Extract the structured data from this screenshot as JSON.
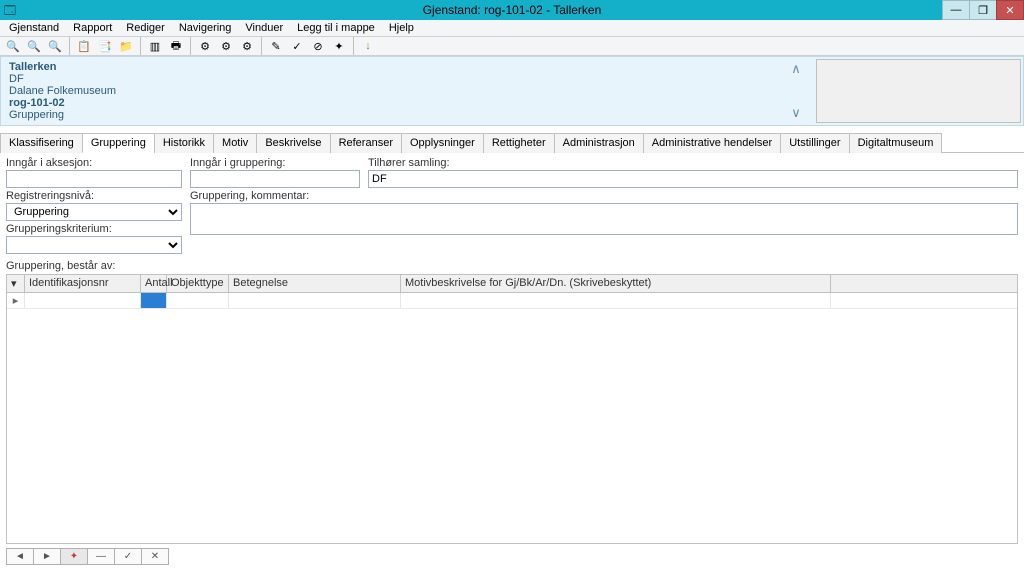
{
  "window": {
    "title": "Gjenstand: rog-101-02  - Tallerken"
  },
  "menu": {
    "items": [
      "Gjenstand",
      "Rapport",
      "Rediger",
      "Navigering",
      "Vinduer",
      "Legg til i mappe",
      "Hjelp"
    ]
  },
  "info": {
    "name": "Tallerken",
    "code": "DF",
    "museum": "Dalane Folkemuseum",
    "id": "rog-101-02",
    "group": "Gruppering"
  },
  "tabs": [
    "Klassifisering",
    "Gruppering",
    "Historikk",
    "Motiv",
    "Beskrivelse",
    "Referanser",
    "Opplysninger",
    "Rettigheter",
    "Administrasjon",
    "Administrative hendelser",
    "Utstillinger",
    "Digitaltmuseum"
  ],
  "active_tab": 1,
  "labels": {
    "inngar_aksesjon": "Inngår i aksesjon:",
    "inngar_gruppering": "Inngår i gruppering:",
    "tilhorer_samling": "Tilhører samling:",
    "registreringsniva": "Registreringsnivå:",
    "grupperingskriterium": "Grupperingskriterium:",
    "gruppering_kommentar": "Gruppering, kommentar:",
    "gruppering_bestar": "Gruppering,  består av:"
  },
  "values": {
    "inngar_aksesjon": "",
    "inngar_gruppering": "",
    "tilhorer_samling": "DF",
    "registreringsniva": "Gruppering",
    "grupperingskriterium": "",
    "gruppering_kommentar": ""
  },
  "grid": {
    "cols": [
      "Identifikasjonsnr",
      "Antall",
      "Objekttype",
      "Betegnelse",
      "Motivbeskrivelse for Gj/Bk/Ar/Dn. (Skrivebeskyttet)"
    ]
  },
  "nav_icons": [
    "◄",
    "►",
    "✦",
    "—",
    "✓",
    "✕"
  ]
}
